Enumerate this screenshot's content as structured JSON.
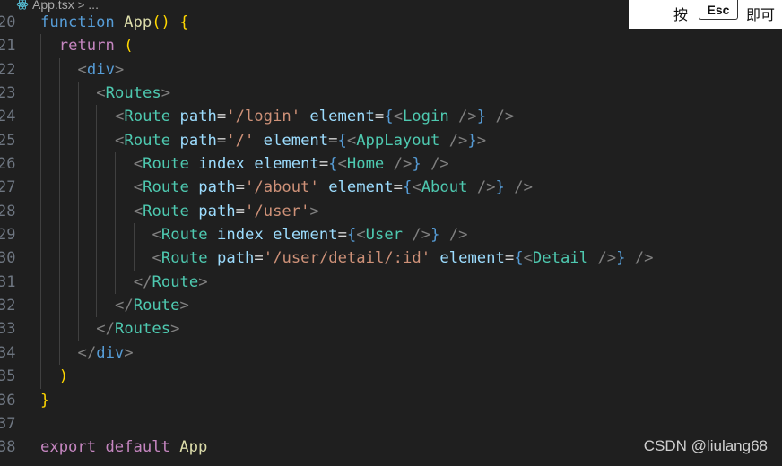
{
  "breadcrumb": {
    "file": "App.tsx",
    "separator": ">",
    "more": "..."
  },
  "toast": {
    "prefix": "按",
    "key": "Esc",
    "suffix": "即可"
  },
  "watermark": "CSDN @liulang68",
  "code": {
    "lines": [
      {
        "num": "20",
        "indent": 0,
        "tokens": [
          [
            "kwb",
            "function"
          ],
          [
            "p",
            " "
          ],
          [
            "fn",
            "App"
          ],
          [
            "br",
            "()"
          ],
          [
            "p",
            " "
          ],
          [
            "br",
            "{"
          ]
        ]
      },
      {
        "num": "21",
        "indent": 1,
        "tokens": [
          [
            "kw",
            "return"
          ],
          [
            "p",
            " "
          ],
          [
            "br",
            "("
          ]
        ]
      },
      {
        "num": "22",
        "indent": 2,
        "tokens": [
          [
            "ang",
            "<"
          ],
          [
            "kwb",
            "div"
          ],
          [
            "ang",
            ">"
          ]
        ]
      },
      {
        "num": "23",
        "indent": 3,
        "tokens": [
          [
            "ang",
            "<"
          ],
          [
            "tag",
            "Routes"
          ],
          [
            "ang",
            ">"
          ]
        ]
      },
      {
        "num": "24",
        "indent": 4,
        "tokens": [
          [
            "ang",
            "<"
          ],
          [
            "tag",
            "Route"
          ],
          [
            "p",
            " "
          ],
          [
            "attr",
            "path"
          ],
          [
            "p",
            "="
          ],
          [
            "str",
            "'/login'"
          ],
          [
            "p",
            " "
          ],
          [
            "attr",
            "element"
          ],
          [
            "p",
            "="
          ],
          [
            "brace",
            "{"
          ],
          [
            "ang",
            "<"
          ],
          [
            "tag",
            "Login"
          ],
          [
            "p",
            " "
          ],
          [
            "ang",
            "/>"
          ],
          [
            "brace",
            "}"
          ],
          [
            "p",
            " "
          ],
          [
            "ang",
            "/>"
          ]
        ]
      },
      {
        "num": "25",
        "indent": 4,
        "tokens": [
          [
            "ang",
            "<"
          ],
          [
            "tag",
            "Route"
          ],
          [
            "p",
            " "
          ],
          [
            "attr",
            "path"
          ],
          [
            "p",
            "="
          ],
          [
            "str",
            "'/'"
          ],
          [
            "p",
            " "
          ],
          [
            "attr",
            "element"
          ],
          [
            "p",
            "="
          ],
          [
            "brace",
            "{"
          ],
          [
            "ang",
            "<"
          ],
          [
            "tag",
            "AppLayout"
          ],
          [
            "p",
            " "
          ],
          [
            "ang",
            "/>"
          ],
          [
            "brace",
            "}"
          ],
          [
            "ang",
            ">"
          ]
        ]
      },
      {
        "num": "26",
        "indent": 5,
        "tokens": [
          [
            "ang",
            "<"
          ],
          [
            "tag",
            "Route"
          ],
          [
            "p",
            " "
          ],
          [
            "attr",
            "index"
          ],
          [
            "p",
            " "
          ],
          [
            "attr",
            "element"
          ],
          [
            "p",
            "="
          ],
          [
            "brace",
            "{"
          ],
          [
            "ang",
            "<"
          ],
          [
            "tag",
            "Home"
          ],
          [
            "p",
            " "
          ],
          [
            "ang",
            "/>"
          ],
          [
            "brace",
            "}"
          ],
          [
            "p",
            " "
          ],
          [
            "ang",
            "/>"
          ]
        ]
      },
      {
        "num": "27",
        "indent": 5,
        "tokens": [
          [
            "ang",
            "<"
          ],
          [
            "tag",
            "Route"
          ],
          [
            "p",
            " "
          ],
          [
            "attr",
            "path"
          ],
          [
            "p",
            "="
          ],
          [
            "str",
            "'/about'"
          ],
          [
            "p",
            " "
          ],
          [
            "attr",
            "element"
          ],
          [
            "p",
            "="
          ],
          [
            "brace",
            "{"
          ],
          [
            "ang",
            "<"
          ],
          [
            "tag",
            "About"
          ],
          [
            "p",
            " "
          ],
          [
            "ang",
            "/>"
          ],
          [
            "brace",
            "}"
          ],
          [
            "p",
            " "
          ],
          [
            "ang",
            "/>"
          ]
        ]
      },
      {
        "num": "28",
        "indent": 5,
        "tokens": [
          [
            "ang",
            "<"
          ],
          [
            "tag",
            "Route"
          ],
          [
            "p",
            " "
          ],
          [
            "attr",
            "path"
          ],
          [
            "p",
            "="
          ],
          [
            "str",
            "'/user'"
          ],
          [
            "ang",
            ">"
          ]
        ]
      },
      {
        "num": "29",
        "indent": 6,
        "tokens": [
          [
            "ang",
            "<"
          ],
          [
            "tag",
            "Route"
          ],
          [
            "p",
            " "
          ],
          [
            "attr",
            "index"
          ],
          [
            "p",
            " "
          ],
          [
            "attr",
            "element"
          ],
          [
            "p",
            "="
          ],
          [
            "brace",
            "{"
          ],
          [
            "ang",
            "<"
          ],
          [
            "tag",
            "User"
          ],
          [
            "p",
            " "
          ],
          [
            "ang",
            "/>"
          ],
          [
            "brace",
            "}"
          ],
          [
            "p",
            " "
          ],
          [
            "ang",
            "/>"
          ]
        ]
      },
      {
        "num": "30",
        "indent": 6,
        "tokens": [
          [
            "ang",
            "<"
          ],
          [
            "tag",
            "Route"
          ],
          [
            "p",
            " "
          ],
          [
            "attr",
            "path"
          ],
          [
            "p",
            "="
          ],
          [
            "str",
            "'/user/detail/:id'"
          ],
          [
            "p",
            " "
          ],
          [
            "attr",
            "element"
          ],
          [
            "p",
            "="
          ],
          [
            "brace",
            "{"
          ],
          [
            "ang",
            "<"
          ],
          [
            "tag",
            "Detail"
          ],
          [
            "p",
            " "
          ],
          [
            "ang",
            "/>"
          ],
          [
            "brace",
            "}"
          ],
          [
            "p",
            " "
          ],
          [
            "ang",
            "/>"
          ]
        ]
      },
      {
        "num": "31",
        "indent": 5,
        "tokens": [
          [
            "ang",
            "</"
          ],
          [
            "tag",
            "Route"
          ],
          [
            "ang",
            ">"
          ]
        ]
      },
      {
        "num": "32",
        "indent": 4,
        "tokens": [
          [
            "ang",
            "</"
          ],
          [
            "tag",
            "Route"
          ],
          [
            "ang",
            ">"
          ]
        ]
      },
      {
        "num": "33",
        "indent": 3,
        "tokens": [
          [
            "ang",
            "</"
          ],
          [
            "tag",
            "Routes"
          ],
          [
            "ang",
            ">"
          ]
        ]
      },
      {
        "num": "34",
        "indent": 2,
        "tokens": [
          [
            "ang",
            "</"
          ],
          [
            "kwb",
            "div"
          ],
          [
            "ang",
            ">"
          ]
        ]
      },
      {
        "num": "35",
        "indent": 1,
        "tokens": [
          [
            "br",
            ")"
          ]
        ]
      },
      {
        "num": "36",
        "indent": 0,
        "tokens": [
          [
            "br",
            "}"
          ]
        ]
      },
      {
        "num": "37",
        "indent": 0,
        "tokens": []
      },
      {
        "num": "38",
        "indent": 0,
        "tokens": [
          [
            "kw",
            "export"
          ],
          [
            "p",
            " "
          ],
          [
            "kw",
            "default"
          ],
          [
            "p",
            " "
          ],
          [
            "fn",
            "App"
          ]
        ]
      }
    ]
  }
}
